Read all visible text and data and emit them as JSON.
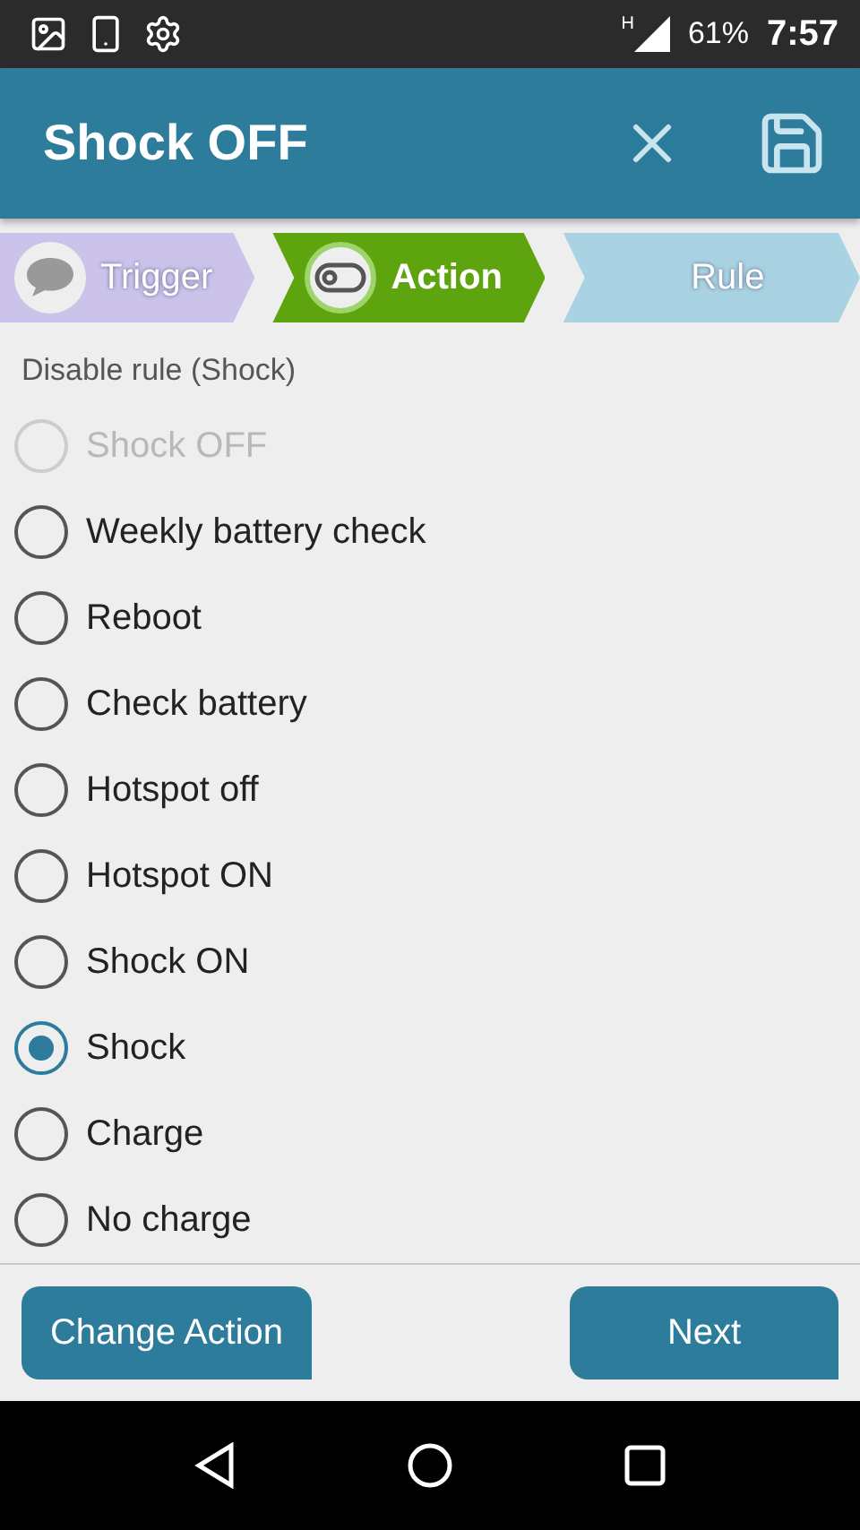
{
  "status_bar": {
    "network": "H",
    "battery": "61%",
    "time": "7:57"
  },
  "header": {
    "title": "Shock OFF"
  },
  "steps": [
    {
      "kind": "trigger",
      "label": "Trigger",
      "selected": false,
      "color": "#cbc3ea"
    },
    {
      "kind": "action",
      "label": "Action",
      "selected": true,
      "color": "#5ea40f"
    },
    {
      "kind": "rule",
      "label": "Rule",
      "selected": false,
      "color": "#a9d3e2"
    }
  ],
  "subtitle": "Disable rule (Shock)",
  "options": [
    {
      "label": "Shock OFF",
      "selected": false,
      "disabled": true
    },
    {
      "label": "Weekly battery check",
      "selected": false,
      "disabled": false
    },
    {
      "label": "Reboot",
      "selected": false,
      "disabled": false
    },
    {
      "label": "Check battery",
      "selected": false,
      "disabled": false
    },
    {
      "label": "Hotspot off",
      "selected": false,
      "disabled": false
    },
    {
      "label": "Hotspot ON",
      "selected": false,
      "disabled": false
    },
    {
      "label": "Shock ON",
      "selected": false,
      "disabled": false
    },
    {
      "label": "Shock",
      "selected": true,
      "disabled": false
    },
    {
      "label": "Charge",
      "selected": false,
      "disabled": false
    },
    {
      "label": "No charge",
      "selected": false,
      "disabled": false
    }
  ],
  "buttons": [
    {
      "label": "Change Action"
    },
    {
      "label": "Next"
    }
  ]
}
